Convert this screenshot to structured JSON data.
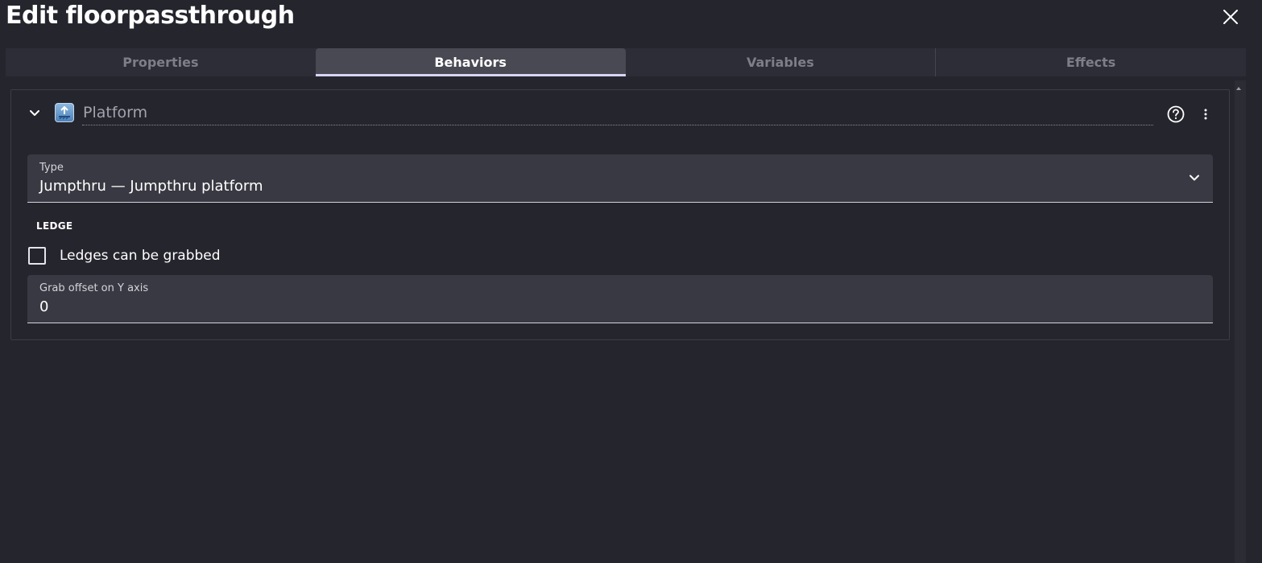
{
  "dialog": {
    "title": "Edit floorpassthrough"
  },
  "tabs": [
    {
      "label": "Properties",
      "active": false
    },
    {
      "label": "Behaviors",
      "active": true
    },
    {
      "label": "Variables",
      "active": false
    },
    {
      "label": "Effects",
      "active": false
    }
  ],
  "behavior": {
    "name": "Platform",
    "icon": "platform-behavior-icon",
    "type_field": {
      "label": "Type",
      "value": "Jumpthru — Jumpthru platform"
    },
    "section_title": "LEDGE",
    "ledge_checkbox": {
      "label": "Ledges can be grabbed",
      "checked": false
    },
    "grab_offset_field": {
      "label": "Grab offset on Y axis",
      "value": "0"
    }
  },
  "colors": {
    "background": "#25252e",
    "tab_bar": "#2d2d37",
    "tab_active": "#494953",
    "tab_indicator": "#d9d3f5",
    "field_bg": "#393943"
  }
}
